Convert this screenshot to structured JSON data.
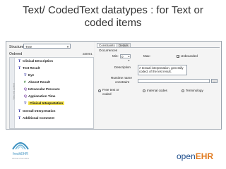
{
  "slide": {
    "title_line1": "Text/ CodedText datatypes : for Text or",
    "title_line2": "coded items"
  },
  "left_panel": {
    "structure_label": "Structure",
    "structure_value": "Tree",
    "ordered_label": "Ordered",
    "ordered_code": "at0001",
    "side_label": "View only Locked"
  },
  "tree": [
    {
      "icon": "T",
      "label": "Clinical Description",
      "selected": false
    },
    {
      "icon": "T",
      "label": "Test Result",
      "selected": false
    },
    {
      "icon": "T",
      "label": "Eye",
      "selected": false
    },
    {
      "icon": "#",
      "label": "Absent Result",
      "selected": false
    },
    {
      "icon": "Q",
      "label": "Intraocular Pressure",
      "selected": false
    },
    {
      "icon": "Q",
      "label": "Applanation Time",
      "selected": false
    },
    {
      "icon": "T",
      "label": "Clinical Interpretation",
      "selected": true
    },
    {
      "icon": "T",
      "label": "Overall Interpretation",
      "selected": false
    },
    {
      "icon": "T",
      "label": "Additional Comment",
      "selected": false
    }
  ],
  "right_panel": {
    "tabs": [
      "Constraints",
      "Details"
    ],
    "occurrences_label": "Occurrences",
    "min_label": "Min:",
    "min_value": "0",
    "max_label": "Max:",
    "unbounded_label": "Unbounded",
    "unbounded_checked": true,
    "description_label": "Description",
    "description_value": "A textual interpretation, generally coded, of the test result.",
    "runtime_label_1": "Runtime name",
    "runtime_label_2": "constraint",
    "dots_label": "...",
    "free_text_label_1": "Free text or",
    "free_text_label_2": "coded",
    "internal_codes_label": "Internal codes",
    "terminology_label": "Terminology"
  },
  "footer": {
    "left_logo_text": "freshEHR",
    "left_logo_sub": "clinical informatics",
    "brand_part1": "open",
    "brand_part2": "EHR"
  },
  "colors": {
    "selection": "#f4e24a",
    "brand_blue": "#1f4e8c",
    "brand_orange": "#e07a1f"
  }
}
